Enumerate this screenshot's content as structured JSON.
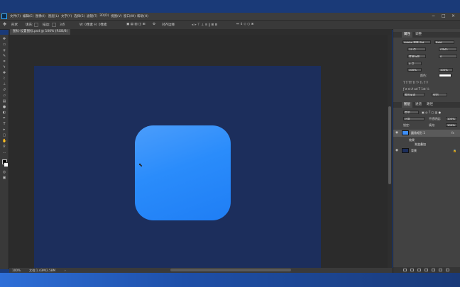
{
  "menu": [
    "文件(F)",
    "编辑(E)",
    "图像(I)",
    "图层(L)",
    "文字(Y)",
    "选择(S)",
    "滤镜(T)",
    "3D(D)",
    "视图(V)",
    "窗口(W)",
    "帮助(H)"
  ],
  "window_controls": [
    "−",
    "□",
    "×"
  ],
  "options": {
    "tool_label": "形状",
    "fill": "填充:",
    "stroke": "描边:",
    "stroke_width": "3点",
    "wh": "W: 0像素  H: 0像素",
    "align_edges": "对齐边缘"
  },
  "document_tab": "图标-设置图标.psd @ 100% (RGB/8)",
  "status": {
    "zoom": "100%",
    "doc_info": "文档:1.43M/2.58M"
  },
  "properties": {
    "tabs": [
      "属性",
      "调整"
    ],
    "font_family": "Adobe 黑体 Std",
    "font_style": "Bold",
    "size": "15 点",
    "leading": "(自动)",
    "tracking": "0",
    "kerning": "度量标准",
    "scale_v": "100%",
    "scale_h": "100%",
    "baseline": "0 点",
    "color_label": "颜色:",
    "antialias": "锐利",
    "lang": "美国英语"
  },
  "layers": {
    "tabs": [
      "图层",
      "通道",
      "路径"
    ],
    "kind_label": "类型",
    "blend": "正常",
    "opacity_label": "不透明度:",
    "opacity": "100%",
    "lock_label": "锁定:",
    "fill_label": "填充:",
    "fill": "100%",
    "items": [
      {
        "name": "圆角矩形 1",
        "fx": true
      },
      {
        "name": "效果",
        "sub": true
      },
      {
        "name": "渐变叠加",
        "sub": true
      },
      {
        "name": "背景"
      }
    ]
  },
  "colors": {
    "canvas_bg": "#1c2e5c",
    "shape_start": "#4b9dfb",
    "shape_end": "#1f7ef5"
  }
}
